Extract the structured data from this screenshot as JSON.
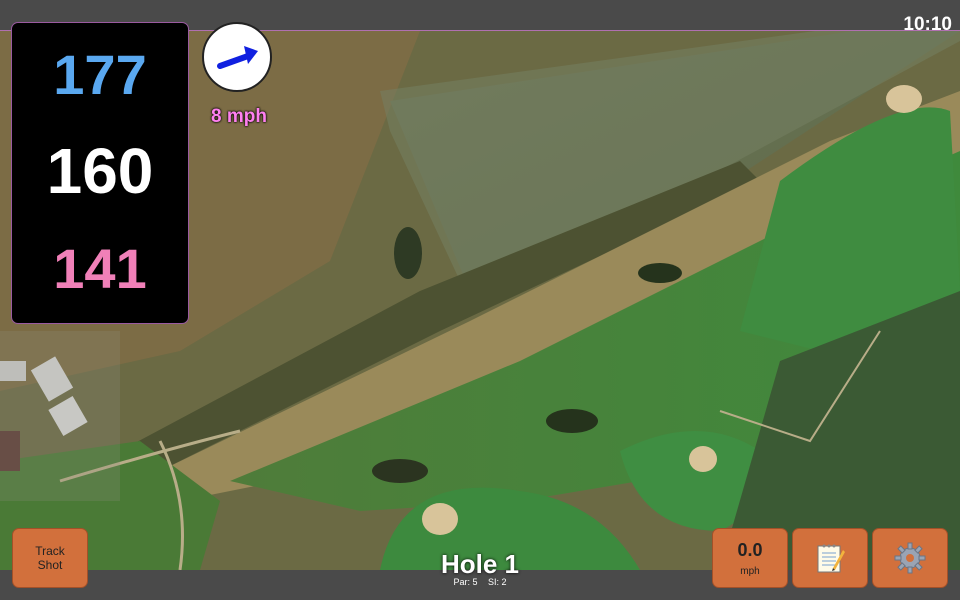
{
  "status_bar": {
    "time": "10:10"
  },
  "yardages": {
    "back": "177",
    "middle": "160",
    "front": "141"
  },
  "wind": {
    "speed": "8 mph",
    "arrow": "arrow-icon"
  },
  "hole": {
    "title": "Hole 1",
    "par": "Par: 5",
    "stroke_index": "SI: 2"
  },
  "buttons": {
    "track_line1": "Track",
    "track_line2": "Shot",
    "speed_value": "0.0",
    "speed_unit": "mph",
    "notes_icon": "notepad-icon",
    "settings_icon": "gear-icon"
  },
  "colors": {
    "back_yardage": "#5aa8f0",
    "middle_yardage": "#ffffff",
    "front_yardage": "#f080b8",
    "button": "#d2703c",
    "wind_text": "#ff80f0"
  }
}
